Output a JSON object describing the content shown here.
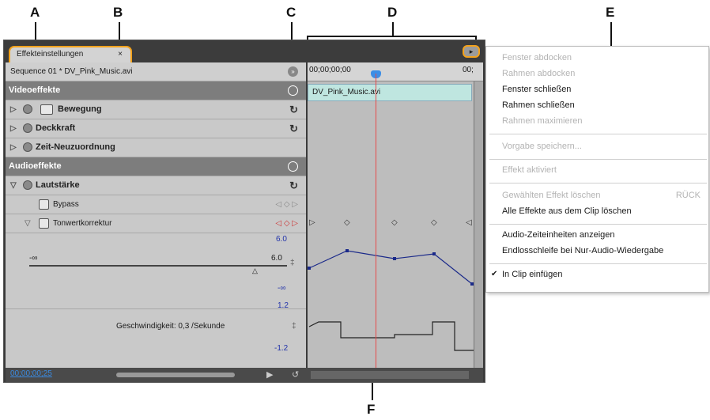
{
  "callouts": [
    "A",
    "B",
    "C",
    "D",
    "E",
    "F"
  ],
  "panel": {
    "tab_label": "Effekteinstellungen",
    "tab_close": "×",
    "sequence_label": "Sequence 01 * DV_Pink_Music.avi",
    "timecode_start": "00;00;00;00",
    "timecode_end": "00;",
    "clip_name": "DV_Pink_Music.avi",
    "video_header": "Videoeffekte",
    "audio_header": "Audioeffekte",
    "effects": [
      "Bewegung",
      "Deckkraft",
      "Zeit-Neuzuordnung",
      "Lautstärke",
      "Bypass",
      "Tonwertkorrektur"
    ],
    "value_max": "6.0",
    "value_min": "-∞",
    "value_current": "6.0",
    "value_neg": "-∞",
    "speed_max": "1.2",
    "speed_min": "-1.2",
    "speed_label": "Geschwindigkeit: 0,3 /Sekunde",
    "current_time": "00;00;00;25"
  },
  "menu": {
    "items": [
      {
        "label": "Fenster abdocken",
        "enabled": false
      },
      {
        "label": "Rahmen abdocken",
        "enabled": false
      },
      {
        "label": "Fenster schließen",
        "enabled": true
      },
      {
        "label": "Rahmen schließen",
        "enabled": true
      },
      {
        "label": "Rahmen maximieren",
        "enabled": false
      },
      {
        "label": "Vorgabe speichern...",
        "enabled": false
      },
      {
        "label": "Effekt aktiviert",
        "enabled": false
      },
      {
        "label": "Gewählten Effekt löschen",
        "enabled": false,
        "shortcut": "RÜCK"
      },
      {
        "label": "Alle Effekte aus dem Clip löschen",
        "enabled": true
      },
      {
        "label": "Audio-Zeiteinheiten anzeigen",
        "enabled": true
      },
      {
        "label": "Endlosschleife bei Nur-Audio-Wiedergabe",
        "enabled": true
      },
      {
        "label": "In Clip einfügen",
        "enabled": true,
        "checked": true
      }
    ],
    "check_mark": "✔"
  },
  "colors": {
    "accent_tab": "#f3a21c",
    "clip": "#bfe6e0",
    "playhead": "#e74a4a",
    "graph": "#1b2a8a"
  },
  "icons": [
    "disclosure-triangle-icon",
    "fx-toggle-icon",
    "reset-icon",
    "keyframe-icon",
    "playhead-icon",
    "panel-menu-icon",
    "checkmark-icon"
  ]
}
